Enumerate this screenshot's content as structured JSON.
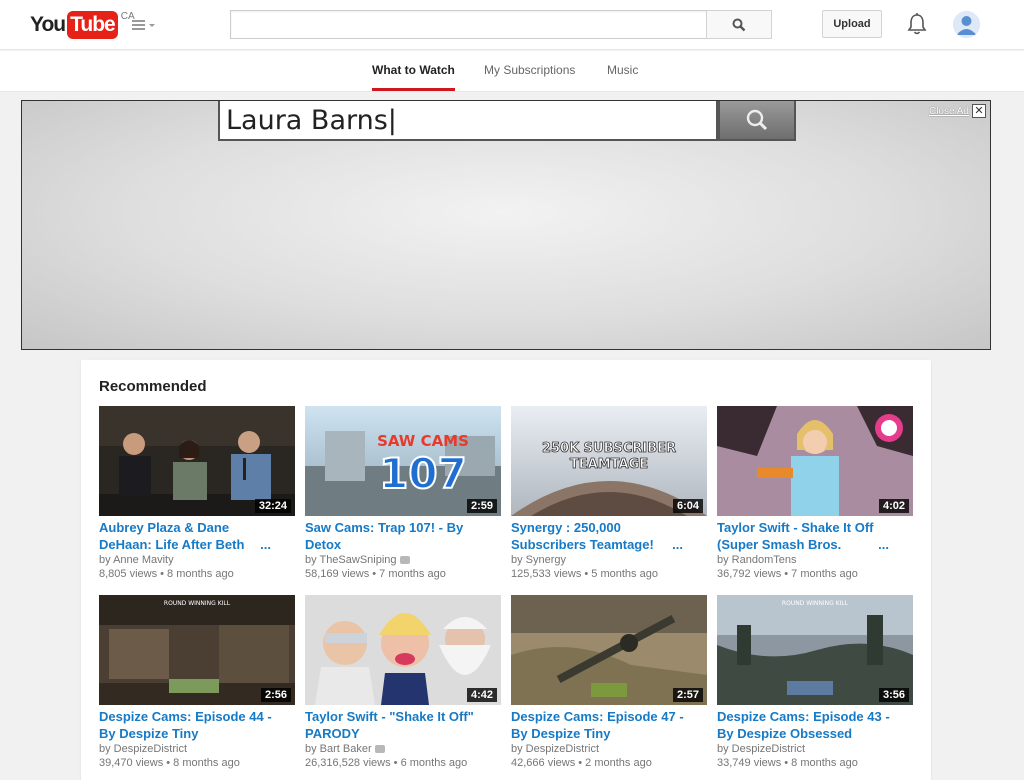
{
  "header": {
    "logo_you": "You",
    "logo_tube": "Tube",
    "region": "CA",
    "search_value": "",
    "upload_label": "Upload",
    "icons": [
      "guide-menu-icon",
      "search-icon",
      "bell-icon",
      "avatar-icon"
    ]
  },
  "tabs": [
    {
      "label": "What to Watch",
      "active": true
    },
    {
      "label": "My Subscriptions",
      "active": false
    },
    {
      "label": "Music",
      "active": false
    }
  ],
  "ad": {
    "search_text": "Laura Barns|",
    "close_label": "Close Ad",
    "close_x": "✕"
  },
  "recommended": {
    "title": "Recommended",
    "videos": [
      {
        "title_line1": "Aubrey Plaza & Dane",
        "title_line2": "DeHaan: Life After Beth",
        "ellipsis": "...",
        "channel": "by Anne Mavity",
        "meta": "8,805 views • 8 months ago",
        "duration": "32:24",
        "verified": false
      },
      {
        "title_line1": "Saw Cams: Trap 107! - By",
        "title_line2": "Detox",
        "ellipsis": "",
        "channel": "by TheSawSniping",
        "meta": "58,169 views • 7 months ago",
        "duration": "2:59",
        "verified": true
      },
      {
        "title_line1": "Synergy : 250,000",
        "title_line2": "Subscribers Teamtage!",
        "ellipsis": "...",
        "channel": "by Synergy",
        "meta": "125,533 views • 5 months ago",
        "duration": "6:04",
        "verified": false
      },
      {
        "title_line1": "Taylor Swift - Shake It Off",
        "title_line2": "(Super Smash Bros.",
        "ellipsis": "...",
        "channel": "by RandomTens",
        "meta": "36,792 views • 7 months ago",
        "duration": "4:02",
        "verified": false
      },
      {
        "title_line1": "Despize Cams: Episode 44 -",
        "title_line2": "By Despize Tiny",
        "ellipsis": "",
        "channel": "by DespizeDistrict",
        "meta": "39,470 views • 8 months ago",
        "duration": "2:56",
        "verified": false
      },
      {
        "title_line1": "Taylor Swift - \"Shake It Off\"",
        "title_line2": "PARODY",
        "ellipsis": "",
        "channel": "by Bart Baker",
        "meta": "26,316,528 views • 6 months ago",
        "duration": "4:42",
        "verified": true
      },
      {
        "title_line1": "Despize Cams: Episode 47 -",
        "title_line2": "By Despize Tiny",
        "ellipsis": "",
        "channel": "by DespizeDistrict",
        "meta": "42,666 views • 2 months ago",
        "duration": "2:57",
        "verified": false
      },
      {
        "title_line1": "Despize Cams: Episode 43 -",
        "title_line2": "By Despize Obsessed",
        "ellipsis": "",
        "channel": "by DespizeDistrict",
        "meta": "33,749 views • 8 months ago",
        "duration": "3:56",
        "verified": false
      }
    ],
    "thumb_text": {
      "saw_cams": "SAW CAMS",
      "saw_num": "107",
      "synergy_line1": "250K SUBSCRIBER",
      "synergy_line2": "TEAMTAGE",
      "kill_text": "ROUND WINNING KILL"
    }
  },
  "colors": {
    "brand_red": "#e62117",
    "link_blue": "#167ac6",
    "tab_underline": "#cc181e"
  }
}
